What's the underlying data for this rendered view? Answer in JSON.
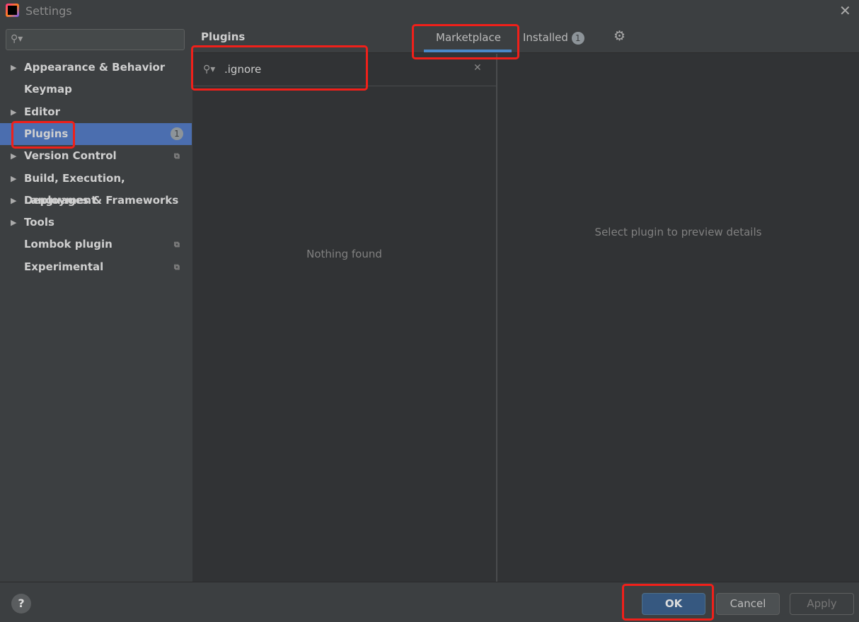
{
  "window": {
    "title": "Settings",
    "logo_text": "IJ"
  },
  "sidebar": {
    "search_placeholder": "",
    "items": [
      {
        "label": "Appearance & Behavior",
        "expandable": true
      },
      {
        "label": "Keymap",
        "expandable": false
      },
      {
        "label": "Editor",
        "expandable": true
      },
      {
        "label": "Plugins",
        "expandable": false,
        "selected": true,
        "badge": "1"
      },
      {
        "label": "Version Control",
        "expandable": true,
        "project_icon": true
      },
      {
        "label": "Build, Execution, Deployment",
        "expandable": true
      },
      {
        "label": "Languages & Frameworks",
        "expandable": true
      },
      {
        "label": "Tools",
        "expandable": true
      },
      {
        "label": "Lombok plugin",
        "expandable": false,
        "project_icon": true
      },
      {
        "label": "Experimental",
        "expandable": false,
        "project_icon": true
      }
    ]
  },
  "plugins": {
    "title": "Plugins",
    "tabs": [
      {
        "label": "Marketplace",
        "active": true
      },
      {
        "label": "Installed",
        "badge": "1"
      }
    ],
    "search_value": ".ignore",
    "empty_text": "Nothing found",
    "preview_text": "Select plugin to preview details"
  },
  "footer": {
    "help": "?",
    "ok": "OK",
    "cancel": "Cancel",
    "apply": "Apply"
  },
  "colors": {
    "accent": "#4b6eaf",
    "tab_underline": "#4a88c7",
    "annotation": "#f0201a"
  }
}
